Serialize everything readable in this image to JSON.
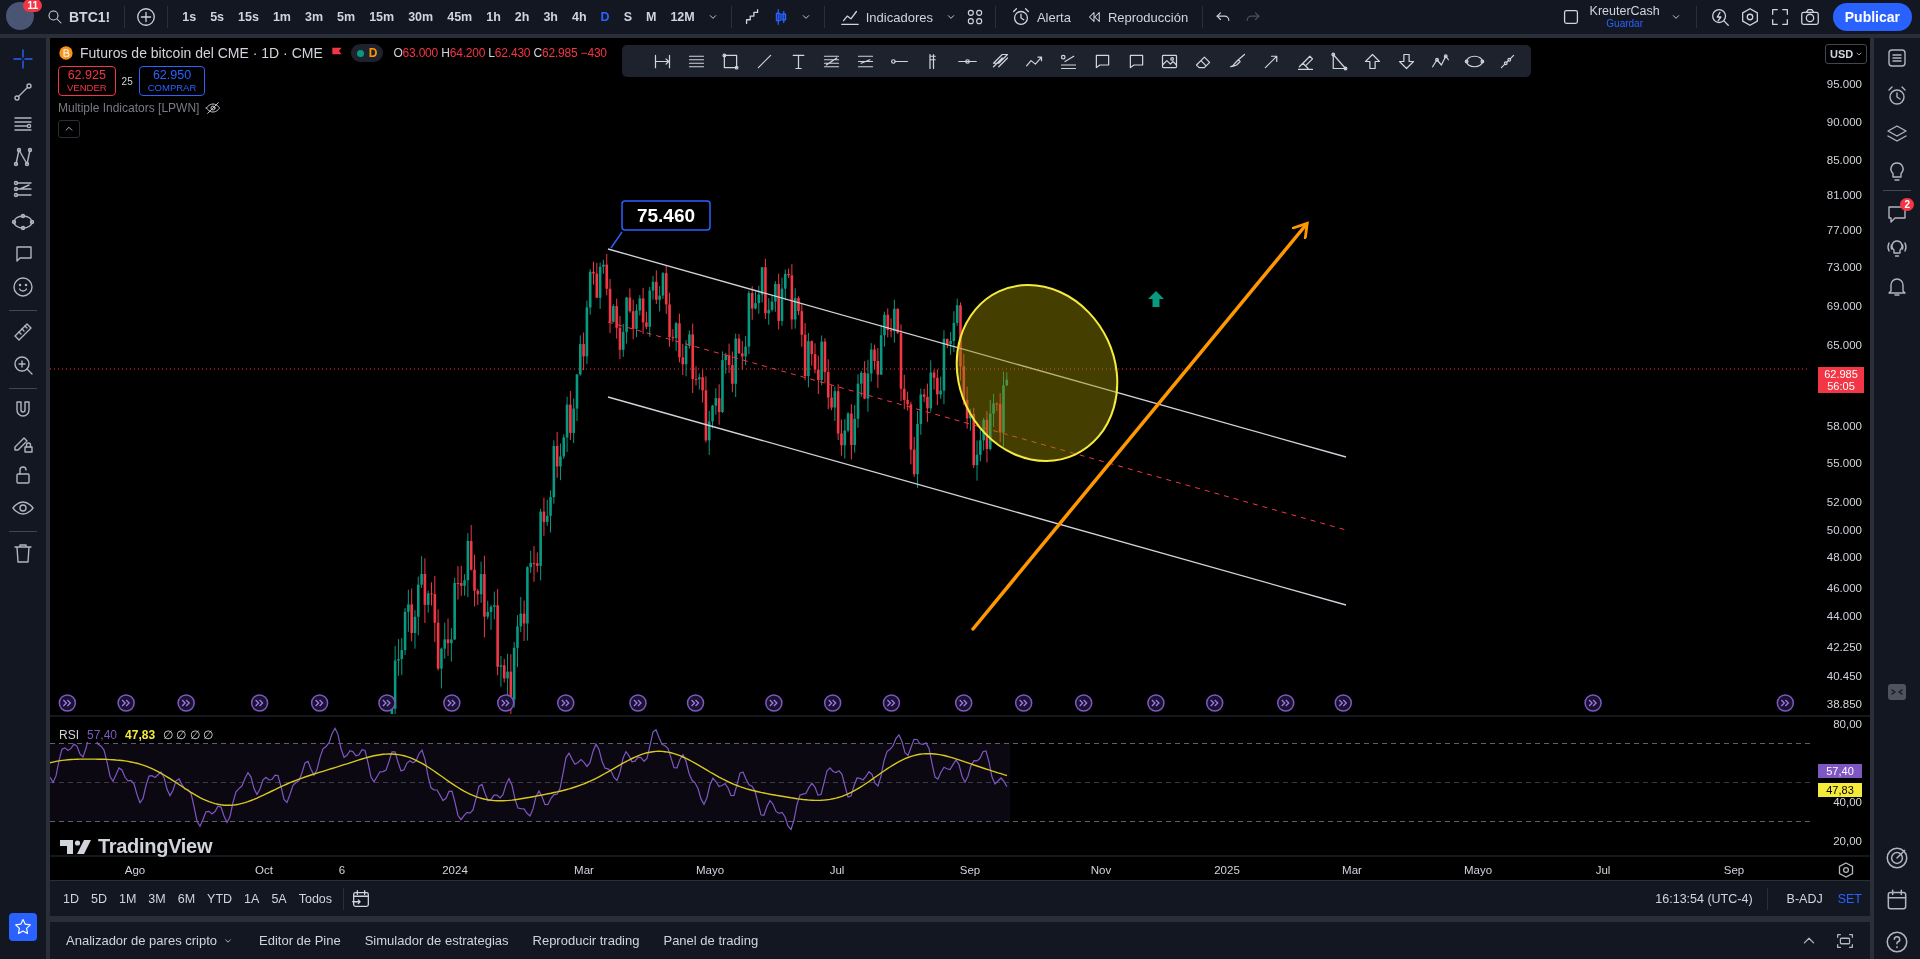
{
  "top_bar": {
    "avatar_badge": "11",
    "symbol": "BTC1!",
    "intervals": [
      {
        "label": "1s",
        "selected": false
      },
      {
        "label": "5s",
        "selected": false
      },
      {
        "label": "15s",
        "selected": false
      },
      {
        "label": "1m",
        "selected": false
      },
      {
        "label": "3m",
        "selected": false
      },
      {
        "label": "5m",
        "selected": false
      },
      {
        "label": "15m",
        "selected": false
      },
      {
        "label": "30m",
        "selected": false
      },
      {
        "label": "45m",
        "selected": false
      },
      {
        "label": "1h",
        "selected": false
      },
      {
        "label": "2h",
        "selected": false
      },
      {
        "label": "3h",
        "selected": false
      },
      {
        "label": "4h",
        "selected": false
      },
      {
        "label": "D",
        "selected": true
      },
      {
        "label": "S",
        "selected": false
      },
      {
        "label": "M",
        "selected": false
      },
      {
        "label": "12M",
        "selected": false
      }
    ],
    "indicators_label": "Indicadores",
    "alert_label": "Alerta",
    "replay_label": "Reproducción",
    "redo_disabled": true,
    "layout_name": "KreuterCash",
    "save_label": "Guardar",
    "publish_label": "Publicar"
  },
  "left_toolbar": {
    "tool_groups": [
      [
        {
          "kind": "crosshair",
          "selected": true
        },
        {
          "kind": "trend-line",
          "selected": false
        },
        {
          "kind": "horizontal-lines",
          "selected": false
        },
        {
          "kind": "pattern",
          "selected": false
        },
        {
          "kind": "fib-channel",
          "selected": false
        },
        {
          "kind": "ellipse",
          "selected": false
        },
        {
          "kind": "callout",
          "selected": false
        },
        {
          "kind": "emoji",
          "selected": false
        }
      ],
      [
        {
          "kind": "ruler",
          "selected": false
        },
        {
          "kind": "zoom-in",
          "selected": false
        }
      ],
      [
        {
          "kind": "magnet",
          "selected": false
        },
        {
          "kind": "pencil-lock",
          "selected": false
        },
        {
          "kind": "lock",
          "selected": false
        },
        {
          "kind": "eye",
          "selected": false
        }
      ],
      [
        {
          "kind": "trash",
          "selected": false
        }
      ]
    ]
  },
  "legend": {
    "title": "Futuros de bitcoin del CME · 1D · CME",
    "session_badge": "D",
    "ohlc": [
      {
        "label": "O",
        "value": "63.000"
      },
      {
        "label": "H",
        "value": "64.200"
      },
      {
        "label": "L",
        "value": "62.430"
      },
      {
        "label": "C",
        "value": "62.985"
      }
    ],
    "change": "−430",
    "sell": {
      "price": "62.925",
      "label": "VENDER"
    },
    "spread": "25",
    "buy": {
      "price": "62.950",
      "label": "COMPRAR"
    },
    "indicator": "Multiple Indicators [LPWN]"
  },
  "price_axis": {
    "currency": "USD",
    "ticks": [
      "95.000",
      "90.000",
      "85.000",
      "81.000",
      "77.000",
      "73.000",
      "69.000",
      "65.000",
      "58.000",
      "55.000",
      "52.000",
      "50.000",
      "48.000",
      "46.000",
      "44.000",
      "42.250",
      "40.450",
      "38.850"
    ],
    "last_price": "62.985",
    "countdown": "56:05"
  },
  "annotations": {
    "callout": "75.460"
  },
  "rsi": {
    "label": "RSI",
    "value": "57,40",
    "ma_value": "47,83",
    "params": "∅ ∅ ∅ ∅",
    "ticks": [
      "80,00",
      "40,00",
      "20,00"
    ],
    "axis_value": "57,40",
    "axis_ma_value": "47,83"
  },
  "branding": "TradingView",
  "time_axis": {
    "labels": [
      "Ago",
      "Oct",
      "6",
      "2024",
      "Mar",
      "Mayo",
      "Jul",
      "Sep",
      "Nov",
      "2025",
      "Mar",
      "Mayo",
      "Jul",
      "Sep"
    ]
  },
  "range_bar": {
    "ranges": [
      "1D",
      "5D",
      "1M",
      "3M",
      "6M",
      "YTD",
      "1A",
      "5A",
      "Todos"
    ],
    "clock": "16:13:54 (UTC-4)",
    "adjustment": "B-ADJ",
    "session": "SET"
  },
  "bottom_panel": {
    "tabs": [
      {
        "label": "Analizador de pares cripto",
        "dropdown": true
      },
      {
        "label": "Editor de Pine",
        "dropdown": false
      },
      {
        "label": "Simulador de estrategias",
        "dropdown": false
      },
      {
        "label": "Reproducir trading",
        "dropdown": false
      },
      {
        "label": "Panel de trading",
        "dropdown": false
      }
    ]
  },
  "right_sidebar": {
    "chat_badge": "2"
  }
}
